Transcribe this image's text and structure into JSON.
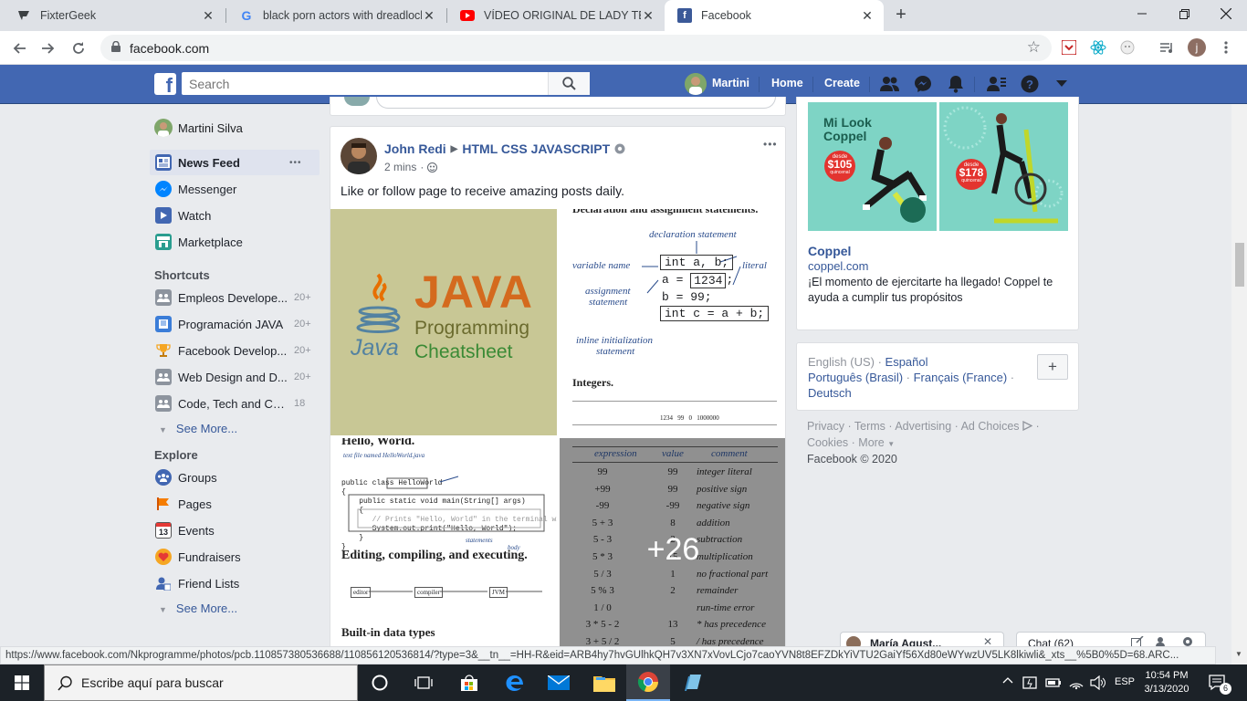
{
  "browser": {
    "tabs": [
      {
        "title": "FixterGeek",
        "favicon": "fixtergeek-icon"
      },
      {
        "title": "black porn actors with dreadlocks",
        "favicon": "google-icon"
      },
      {
        "title": "VÍDEO ORIGINAL DE LADY TERM",
        "favicon": "youtube-icon"
      },
      {
        "title": "Facebook",
        "favicon": "facebook-icon"
      }
    ],
    "new_tab_symbol": "+",
    "url": "facebook.com",
    "status_url": "https://www.facebook.com/Nkprogramme/photos/pcb.110857380536688/110856120536814/?type=3&__tn__=HH-R&eid=ARB4hy7hvGUlhkQH7v3XN7xVovLCjo7caoYVN8t8EFZDkYiVTU2GaiYf56Xd80eWYwzUV5LK8lkiwli&_xts__%5B0%5D=68.ARC..."
  },
  "fb": {
    "search_placeholder": "Search",
    "user_name": "Martini",
    "nav_home": "Home",
    "nav_create": "Create"
  },
  "left_nav": {
    "profile_name": "Martini Silva",
    "main": [
      {
        "label": "News Feed",
        "icon": "news-feed-icon",
        "more": "•••"
      },
      {
        "label": "Messenger",
        "icon": "messenger-icon"
      },
      {
        "label": "Watch",
        "icon": "watch-icon"
      },
      {
        "label": "Marketplace",
        "icon": "marketplace-icon"
      }
    ],
    "shortcuts_header": "Shortcuts",
    "shortcuts": [
      {
        "label": "Empleos Develope...",
        "count": "20+"
      },
      {
        "label": "Programación JAVA",
        "count": "20+"
      },
      {
        "label": "Facebook Develop...",
        "count": "20+"
      },
      {
        "label": "Web Design and D...",
        "count": "20+"
      },
      {
        "label": "Code, Tech and Ca...",
        "count": "18"
      }
    ],
    "see_more": "See More...",
    "explore_header": "Explore",
    "explore": [
      {
        "label": "Groups",
        "icon": "groups-icon"
      },
      {
        "label": "Pages",
        "icon": "pages-icon"
      },
      {
        "label": "Events",
        "icon": "events-icon"
      },
      {
        "label": "Fundraisers",
        "icon": "fundraisers-icon"
      },
      {
        "label": "Friend Lists",
        "icon": "friend-lists-icon"
      }
    ],
    "see_more_2": "See More..."
  },
  "post": {
    "author": "John Redi",
    "page": "HTML CSS JAVASCRIPT",
    "time": "2 mins",
    "text": "Like or follow page to receive amazing posts daily.",
    "options": "•••",
    "java_title": "JAVA",
    "java_sub1": "Programming",
    "java_sub2": "Cheatsheet",
    "java_word": "Java",
    "img2": {
      "heading_top": "Declaration and assignment statements.",
      "declaration_statement": "declaration statement",
      "code1": "int a, b;",
      "variable_name": "variable name",
      "literal": "literal",
      "code2_a": "a = ",
      "code2_b": "1234",
      "code2_c": ";",
      "assignment": "assignment",
      "statement": "statement",
      "code3": "b = 99;",
      "code4": "int c = a + b;",
      "inline_init": "inline initialization",
      "statement2": "statement",
      "integers": "Integers.",
      "tiny_row": "1234   99   0   1000000"
    },
    "img3": {
      "hello": "Hello, World.",
      "text_file": "text file named HelloWorld.java",
      "code_l1": "public class HelloWorld",
      "code_l2": "{",
      "code_l3": "public static void main(String[] args)",
      "code_l4": "{",
      "code_l5": "// Prints \"Hello, World\" in the terminal window.",
      "code_l6": "System.out.print(\"Hello, World\");",
      "code_l7": "}",
      "code_l8": "}",
      "statements": "statements",
      "body": "body",
      "editing": "Editing, compiling, and executing.",
      "box1": "editor",
      "box2": "compiler",
      "box3": "JVM",
      "builtin": "Built-in data types"
    },
    "img4": {
      "h_expr": "expression",
      "h_value": "value",
      "h_comment": "comment",
      "rows": [
        [
          "99",
          "99",
          "integer literal"
        ],
        [
          "+99",
          "99",
          "positive sign"
        ],
        [
          "-99",
          "-99",
          "negative sign"
        ],
        [
          "5 + 3",
          "8",
          "addition"
        ],
        [
          "5 - 3",
          "2",
          "subtraction"
        ],
        [
          "5 * 3",
          "15",
          "multiplication"
        ],
        [
          "5 / 3",
          "1",
          "no fractional part"
        ],
        [
          "5 % 3",
          "2",
          "remainder"
        ],
        [
          "1 / 0",
          "",
          "run-time error"
        ],
        [
          "3 * 5 - 2",
          "13",
          "* has precedence"
        ],
        [
          "3 + 5 / 2",
          "5",
          "/ has precedence"
        ]
      ],
      "more": "+26"
    }
  },
  "ad": {
    "img_title_1": "Mi Look",
    "img_title_2": "Coppel",
    "price1_small": "desde",
    "price1": "$105",
    "price1_note": "quincenal",
    "price2_small": "desde",
    "price2": "$178",
    "price2_note": "quincenal",
    "name": "Coppel",
    "domain": "coppel.com",
    "text": "¡El momento de ejercitarte ha llegado! Coppel te ayuda a cumplir tus propósitos"
  },
  "languages": {
    "current": "English (US)",
    "links": [
      "Español",
      "Português (Brasil)",
      "Français (France)",
      "Deutsch"
    ],
    "add_symbol": "+"
  },
  "footer": {
    "links": [
      "Privacy",
      "Terms",
      "Advertising",
      "Ad Choices",
      "Cookies",
      "More"
    ],
    "copyright": "Facebook © 2020"
  },
  "chat": {
    "tab1": "María Agust...",
    "tab2": "Chat (62)"
  },
  "taskbar": {
    "search_placeholder": "Escribe aquí para buscar",
    "language": "ESP",
    "time": "10:54 PM",
    "date": "3/13/2020",
    "notifications": "6"
  }
}
